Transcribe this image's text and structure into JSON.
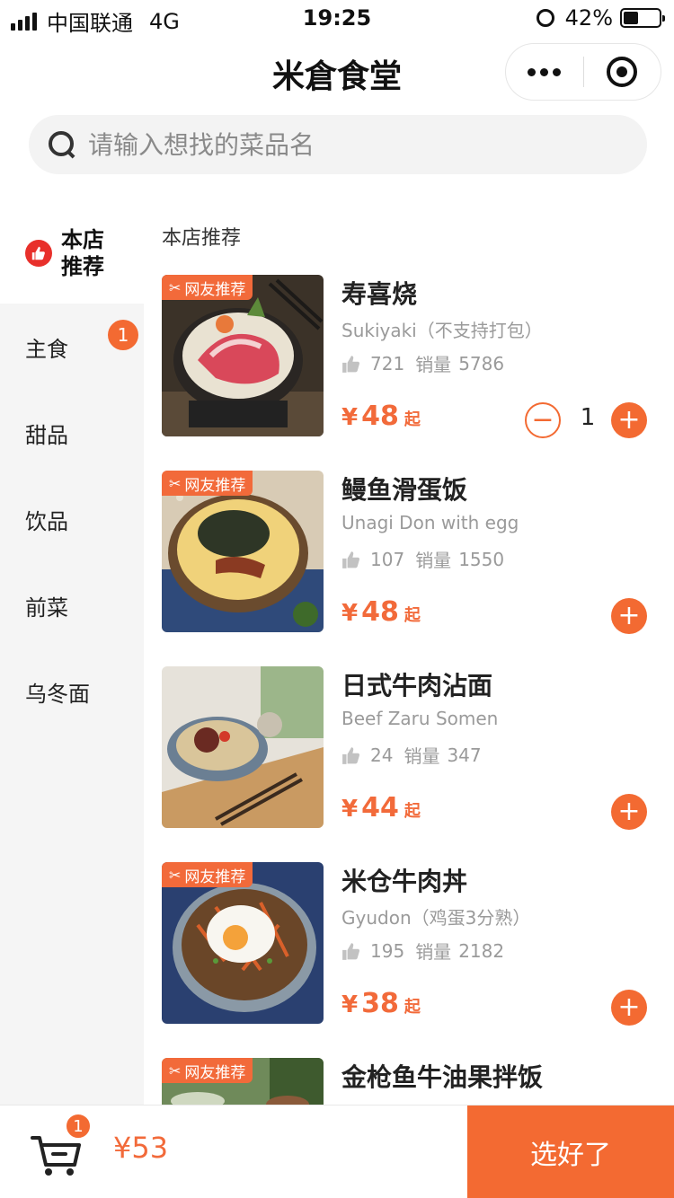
{
  "status_bar": {
    "carrier": "中国联通",
    "network": "4G",
    "time": "19:25",
    "battery": "42%",
    "battery_level": 0.42
  },
  "nav": {
    "title": "米倉食堂"
  },
  "search": {
    "placeholder": "请输入想找的菜品名",
    "value": ""
  },
  "sidebar": {
    "active_label": "本店推荐",
    "items": [
      {
        "label": "主食",
        "badge": "1"
      },
      {
        "label": "甜品"
      },
      {
        "label": "饮品"
      },
      {
        "label": "前菜"
      },
      {
        "label": "乌冬面"
      }
    ]
  },
  "section": {
    "title": "本店推荐"
  },
  "common": {
    "tag": "网友推荐",
    "currency": "¥",
    "from": "起",
    "sales_label": "销量",
    "plus": "+",
    "minus": "−"
  },
  "dishes": [
    {
      "name": "寿喜烧",
      "subtitle": "Sukiyaki（不支持打包）",
      "likes": "721",
      "sales": "5786",
      "price": "48",
      "qty": "1",
      "tagged": true
    },
    {
      "name": "鳗鱼滑蛋饭",
      "subtitle": "Unagi Don with egg",
      "likes": "107",
      "sales": "1550",
      "price": "48",
      "tagged": true
    },
    {
      "name": "日式牛肉沾面",
      "subtitle": "Beef Zaru Somen",
      "likes": "24",
      "sales": "347",
      "price": "44",
      "tagged": false
    },
    {
      "name": "米仓牛肉丼",
      "subtitle": "Gyudon（鸡蛋3分熟）",
      "likes": "195",
      "sales": "2182",
      "price": "38",
      "tagged": true
    },
    {
      "name": "金枪鱼牛油果拌饭",
      "tagged": true
    }
  ],
  "cart": {
    "count": "1",
    "total": "¥53",
    "checkout_label": "选好了"
  },
  "colors": {
    "accent": "#f36a32",
    "price": "#f26a3a",
    "sidebar_bg": "#f5f5f5",
    "like_badge": "#e8302b"
  },
  "icons": [
    "signal-icon",
    "alarm-icon",
    "battery-icon",
    "more-icon",
    "close-target-icon",
    "search-icon",
    "thumbs-up-icon",
    "chef-icon",
    "cart-icon"
  ]
}
